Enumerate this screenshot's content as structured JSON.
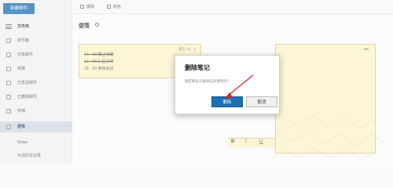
{
  "sidebar": {
    "new_mail_label": "新建邮件",
    "items": [
      {
        "label": "文件夹"
      },
      {
        "label": "收件箱"
      },
      {
        "label": "垃圾邮件"
      },
      {
        "label": "草稿"
      },
      {
        "label": "已发送邮件"
      },
      {
        "label": "已删除邮件"
      },
      {
        "label": "存档"
      },
      {
        "label": "便笺"
      },
      {
        "label": "Notes"
      },
      {
        "label": "对话历史记录"
      }
    ]
  },
  "toolbar": {
    "delete_label": "删除",
    "color_label": "颜色"
  },
  "notes": {
    "title": "便笺",
    "main_note": {
      "lines": [
        "14：30 截止日期",
        "14：30 C 区工作",
        "16：00 参加会议"
      ],
      "meta": "周五 10：4"
    },
    "format": {
      "bold": "B",
      "italic": "I",
      "underline": "U"
    }
  },
  "dialog": {
    "title": "删除笔记",
    "message": "确定要永久删除这条便笺吗？",
    "delete_label": "删除",
    "cancel_label": "取消"
  },
  "colors": {
    "accent": "#1f6fb3",
    "note_bg": "#fdf3c8",
    "arrow": "#e02020"
  }
}
